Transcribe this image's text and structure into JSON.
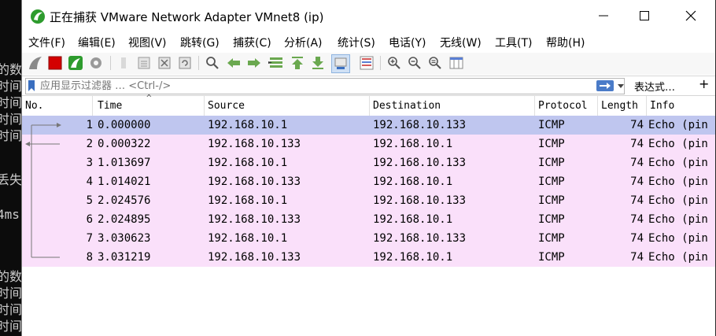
{
  "background": {
    "terminal_lines": [
      "的数",
      "时间",
      "时间",
      "时间",
      "时间",
      "丢失",
      "4ms",
      "的数",
      "时间",
      "时间",
      "时间"
    ]
  },
  "window": {
    "title": "正在捕获 VMware Network Adapter VMnet8 (ip)"
  },
  "menu": {
    "items": [
      "文件(F)",
      "编辑(E)",
      "视图(V)",
      "跳转(G)",
      "捕获(C)",
      "分析(A)",
      "统计(S)",
      "电话(Y)",
      "无线(W)",
      "工具(T)",
      "帮助(H)"
    ]
  },
  "toolbar": {
    "icons": [
      "shark-fin-start-icon",
      "stop-square-icon",
      "restart-fin-icon",
      "capture-options-gear-icon",
      "open-file-icon",
      "save-file-icon",
      "close-file-icon",
      "reload-icon",
      "find-packet-icon",
      "go-back-icon",
      "go-forward-icon",
      "go-to-packet-icon",
      "go-first-icon",
      "go-last-icon",
      "autoscroll-icon",
      "colorize-icon",
      "zoom-in-icon",
      "zoom-out-icon",
      "zoom-normal-icon",
      "resize-columns-icon"
    ]
  },
  "filter": {
    "placeholder": "应用显示过滤器 … <Ctrl-/>",
    "expression_label": "表达式…",
    "add_label": "+"
  },
  "packet_list": {
    "columns": [
      "No.",
      "Time",
      "Source",
      "Destination",
      "Protocol",
      "Length",
      "Info"
    ],
    "rows": [
      {
        "no": "1",
        "time": "0.000000",
        "source": "192.168.10.1",
        "destination": "192.168.10.133",
        "protocol": "ICMP",
        "length": "74",
        "info": "Echo (pin"
      },
      {
        "no": "2",
        "time": "0.000322",
        "source": "192.168.10.133",
        "destination": "192.168.10.1",
        "protocol": "ICMP",
        "length": "74",
        "info": "Echo (pin"
      },
      {
        "no": "3",
        "time": "1.013697",
        "source": "192.168.10.1",
        "destination": "192.168.10.133",
        "protocol": "ICMP",
        "length": "74",
        "info": "Echo (pin"
      },
      {
        "no": "4",
        "time": "1.014021",
        "source": "192.168.10.133",
        "destination": "192.168.10.1",
        "protocol": "ICMP",
        "length": "74",
        "info": "Echo (pin"
      },
      {
        "no": "5",
        "time": "2.024576",
        "source": "192.168.10.1",
        "destination": "192.168.10.133",
        "protocol": "ICMP",
        "length": "74",
        "info": "Echo (pin"
      },
      {
        "no": "6",
        "time": "2.024895",
        "source": "192.168.10.133",
        "destination": "192.168.10.1",
        "protocol": "ICMP",
        "length": "74",
        "info": "Echo (pin"
      },
      {
        "no": "7",
        "time": "3.030623",
        "source": "192.168.10.1",
        "destination": "192.168.10.133",
        "protocol": "ICMP",
        "length": "74",
        "info": "Echo (pin"
      },
      {
        "no": "8",
        "time": "3.031219",
        "source": "192.168.10.133",
        "destination": "192.168.10.1",
        "protocol": "ICMP",
        "length": "74",
        "info": "Echo (pin"
      }
    ],
    "selected_row": "1"
  },
  "colors": {
    "selected_row": "#bfc6ef",
    "icmp_row": "#fae0fa",
    "accent": "#4a7bc8",
    "stop_red": "#d40000",
    "fin_green": "#2d9b2d"
  }
}
